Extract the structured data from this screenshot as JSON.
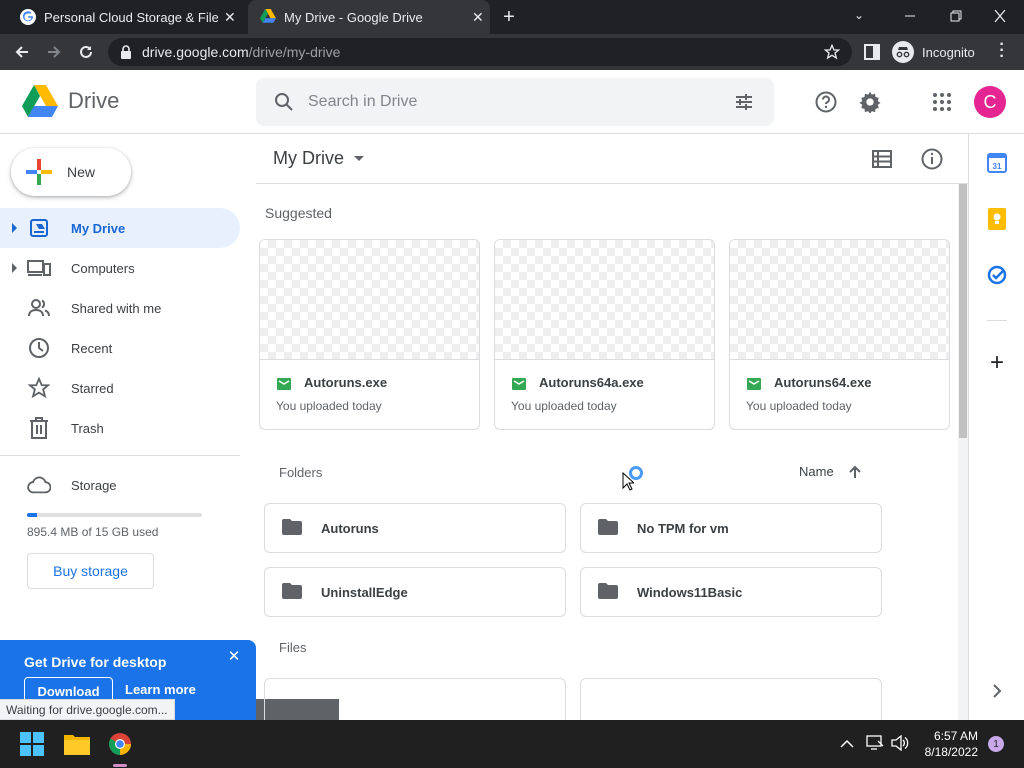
{
  "browser": {
    "tabs": [
      {
        "title": "Personal Cloud Storage & File Sh",
        "active": false
      },
      {
        "title": "My Drive - Google Drive",
        "active": true
      }
    ],
    "url_host": "drive.google.com",
    "url_path": "/drive/my-drive",
    "incognito_label": "Incognito",
    "status_text": "Waiting for drive.google.com..."
  },
  "app": {
    "name": "Drive",
    "search_placeholder": "Search in Drive",
    "avatar_letter": "C",
    "avatar_color": "#e52592",
    "accent": "#1a73e8"
  },
  "sidebar": {
    "new_label": "New",
    "items": [
      {
        "label": "My Drive",
        "icon": "my-drive-icon",
        "active": true
      },
      {
        "label": "Computers",
        "icon": "computers-icon"
      },
      {
        "label": "Shared with me",
        "icon": "shared-icon"
      },
      {
        "label": "Recent",
        "icon": "clock-icon"
      },
      {
        "label": "Starred",
        "icon": "star-icon"
      },
      {
        "label": "Trash",
        "icon": "trash-icon"
      }
    ],
    "storage_label": "Storage",
    "storage_used_text": "895.4 MB of 15 GB used",
    "storage_used_fraction": 0.058,
    "buy_storage_label": "Buy storage"
  },
  "promo": {
    "title": "Get Drive for desktop",
    "download_label": "Download",
    "learn_more_label": "Learn more"
  },
  "main": {
    "title": "My Drive",
    "suggested_label": "Suggested",
    "suggested": [
      {
        "name": "Autoruns.exe",
        "sub": "You uploaded today"
      },
      {
        "name": "Autoruns64a.exe",
        "sub": "You uploaded today"
      },
      {
        "name": "Autoruns64.exe",
        "sub": "You uploaded today"
      }
    ],
    "folders_label": "Folders",
    "sort_label": "Name",
    "folders": [
      {
        "name": "Autoruns"
      },
      {
        "name": "No TPM for vm"
      },
      {
        "name": "UninstallEdge"
      },
      {
        "name": "Windows11Basic"
      }
    ],
    "files_label": "Files"
  },
  "taskbar": {
    "time": "6:57 AM",
    "date": "8/18/2022",
    "notification_count": "1"
  }
}
